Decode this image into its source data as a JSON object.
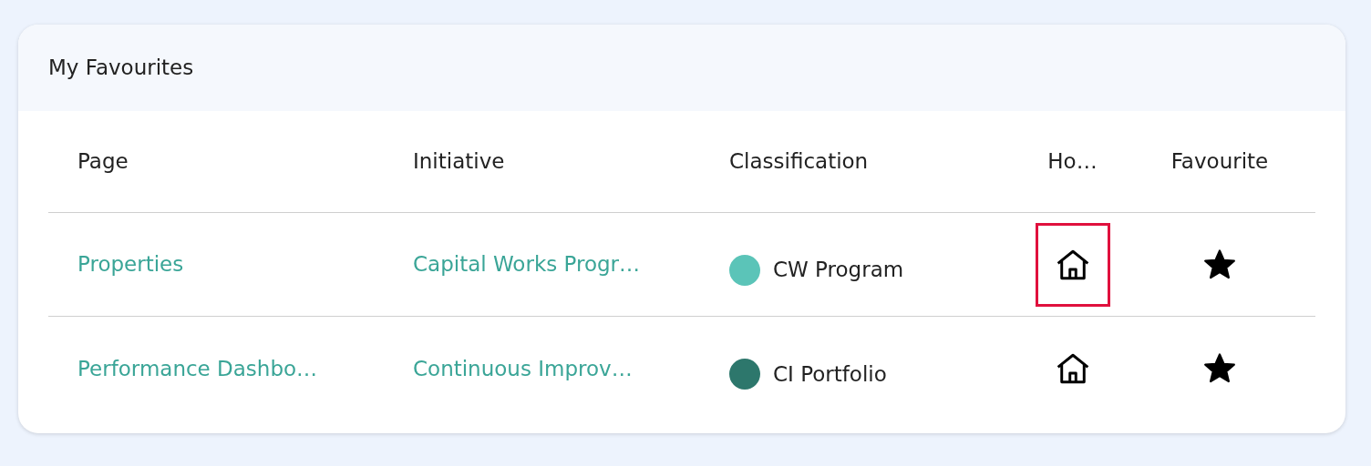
{
  "card": {
    "title": "My Favourites"
  },
  "table": {
    "columns": [
      "Page",
      "Initiative",
      "Classification",
      "Ho…",
      "Favourite"
    ],
    "rows": [
      {
        "page": "Properties",
        "initiative": "Capital Works Progr…",
        "classification": "CW Program",
        "color": "#5bc4b8",
        "home_highlighted": true,
        "favourite": true
      },
      {
        "page": "Performance Dashbo…",
        "initiative": "Continuous Improv…",
        "classification": "CI Portfolio",
        "color": "#2d776c",
        "home_highlighted": false,
        "favourite": true
      }
    ]
  }
}
